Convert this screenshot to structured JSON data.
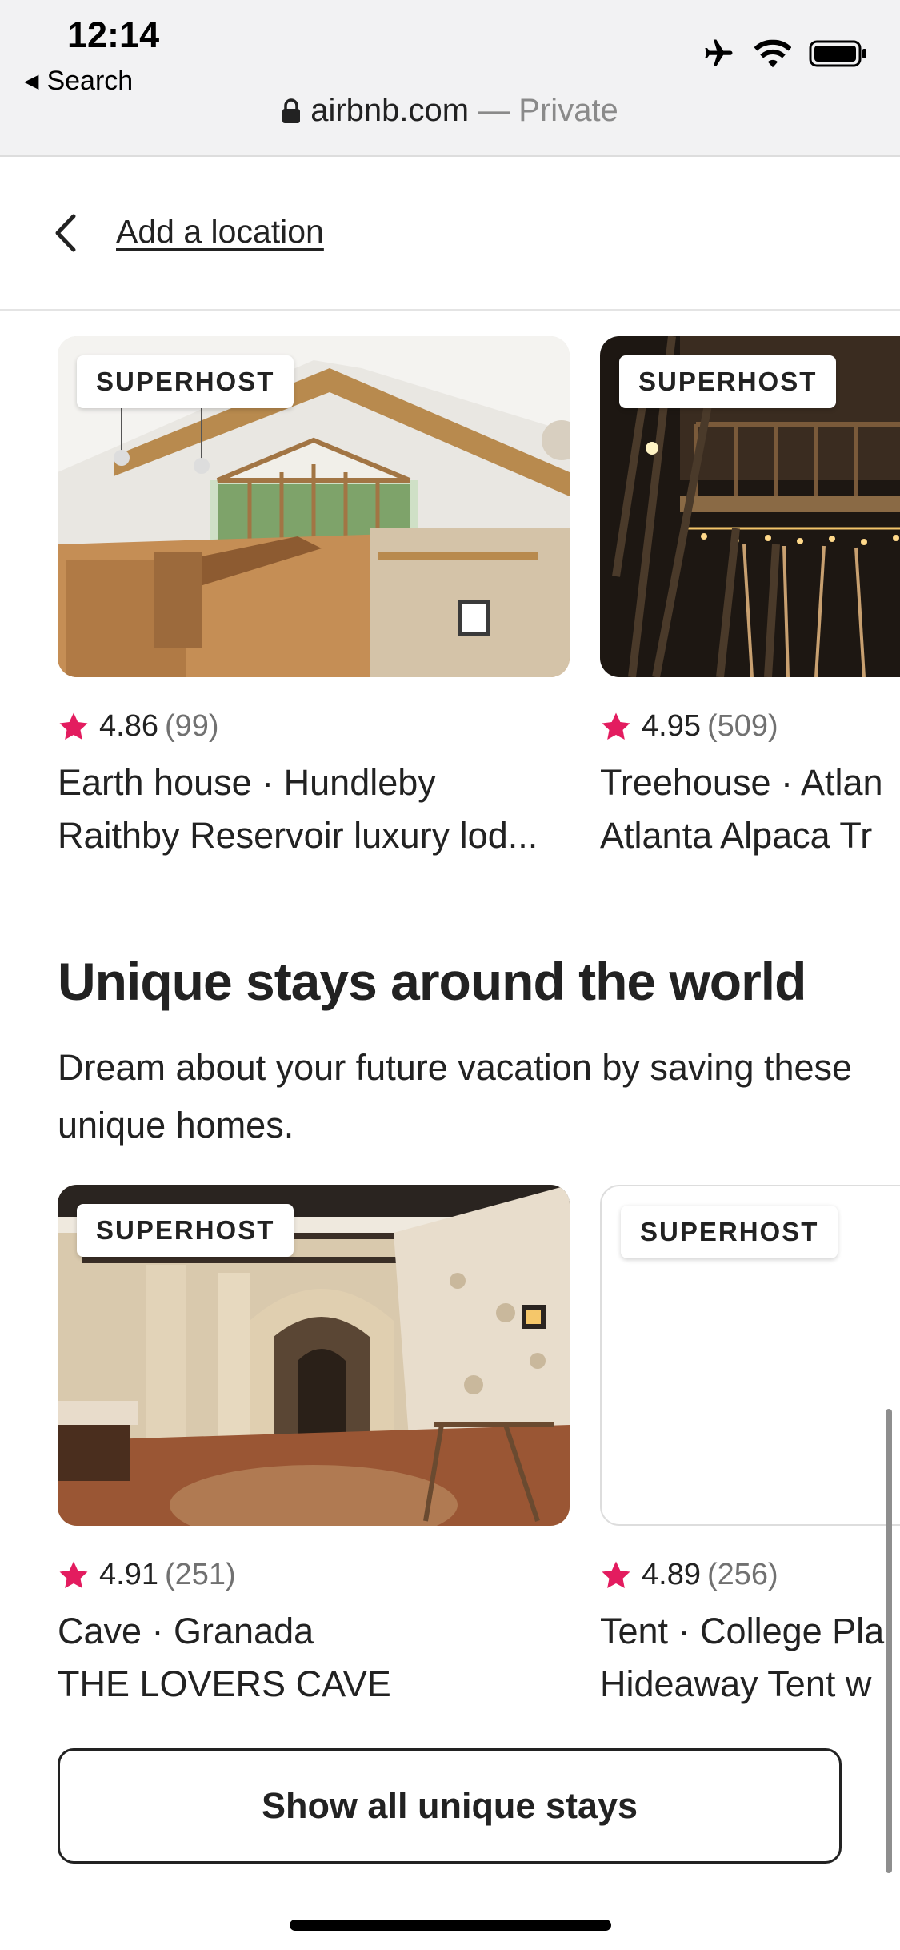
{
  "status_bar": {
    "time": "12:14",
    "back_app": "Search",
    "url": "airbnb.com",
    "private_label": " — Private",
    "icons": [
      "airplane-icon",
      "wifi-icon",
      "battery-icon"
    ]
  },
  "nav": {
    "title": "Add a location"
  },
  "colors": {
    "star": "#E31C5F",
    "text": "#222222",
    "muted": "#717171"
  },
  "row1": [
    {
      "badge": "SUPERHOST",
      "rating": "4.86",
      "count": "(99)",
      "line1": "Earth house · Hundleby",
      "line2": "Raithby Reservoir luxury lod..."
    },
    {
      "badge": "SUPERHOST",
      "rating": "4.95",
      "count": "(509)",
      "line1": "Treehouse · Atlan",
      "line2": "Atlanta Alpaca Tr"
    }
  ],
  "section": {
    "title": "Unique stays around the world",
    "subtitle": "Dream about your future vacation by saving these unique homes."
  },
  "row2": [
    {
      "badge": "SUPERHOST",
      "rating": "4.91",
      "count": "(251)",
      "line1": "Cave · Granada",
      "line2": "THE LOVERS CAVE"
    },
    {
      "badge": "SUPERHOST",
      "rating": "4.89",
      "count": "(256)",
      "line1": "Tent · College Pla",
      "line2": "Hideaway Tent w"
    }
  ],
  "show_all_label": "Show all unique stays"
}
